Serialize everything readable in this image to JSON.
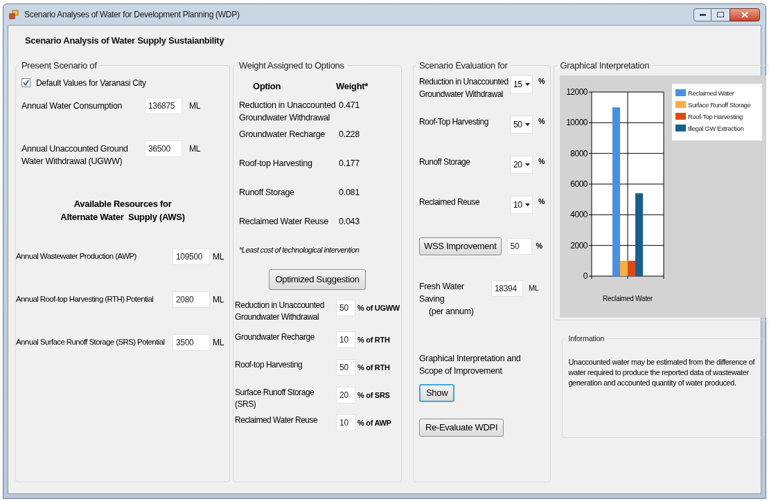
{
  "window": {
    "title": "Scenario Analyses of Water for Development Planning (WDP)"
  },
  "heading": "Scenario Analysis of Water Supply Sustaianbility",
  "present": {
    "title": "Present Scenario of",
    "checkbox": {
      "label": "Default Values for Varanasi City",
      "checked": true
    },
    "fields": [
      {
        "label": "Annual Water Consumption",
        "value": "136875",
        "unit": "ML"
      },
      {
        "label": "Annual Unaccounted Ground Water Withdrawal (UGWW)",
        "value": "36500",
        "unit": "ML"
      }
    ],
    "subheading": [
      "Available Resources for",
      "Alternate Water  Supply (AWS)"
    ],
    "resources": [
      {
        "label": "Annual Wastewater Production (AWP)",
        "value": "109500",
        "unit": "ML"
      },
      {
        "label": "Annual Roof-top Harvesting (RTH) Potential",
        "value": "2080",
        "unit": "ML"
      },
      {
        "label": "Annual Surface Runoff Storage (SRS) Potential",
        "value": "3500",
        "unit": "ML"
      }
    ]
  },
  "weights": {
    "title": "Weight Assigned to Options",
    "columns": [
      "Option",
      "Weight*"
    ],
    "rows": [
      {
        "option": "Reduction in Unaccounted Groundwater Withdrawal",
        "weight": "0.471"
      },
      {
        "option": "Groundwater Recharge",
        "weight": "0.228"
      },
      {
        "option": "Roof-top Harvesting",
        "weight": "0.177"
      },
      {
        "option": "Runoff Storage",
        "weight": "0.081"
      },
      {
        "option": "Reclaimed Water Reuse",
        "weight": "0.043"
      }
    ],
    "footnote": "*Least cost of technological intervention",
    "button": "Optimized Suggestion",
    "suggestions": [
      {
        "label": "Reduction in Unaccounted Groundwater Withdrawal",
        "value": "50",
        "unit": "% of UGWW"
      },
      {
        "label": "Groundwater Recharge",
        "value": "10",
        "unit": "% of RTH"
      },
      {
        "label": "Roof-top Harvesting",
        "value": "50",
        "unit": "% of RTH"
      },
      {
        "label": "Surface Runoff Storage (SRS)",
        "value": "20",
        "unit": "% of SRS"
      },
      {
        "label": "Reclaimed Water Reuse",
        "value": "10",
        "unit": "% of AWP"
      }
    ]
  },
  "evaluation": {
    "title": "Scenario Evaluation for",
    "options": [
      {
        "label": "Reduction in Unaccounted Groundwater Withdrawal",
        "value": "15",
        "unit": "%"
      },
      {
        "label": "Roof-Top Harvesting",
        "value": "50",
        "unit": "%"
      },
      {
        "label": "Runoff Storage",
        "value": "20",
        "unit": "%"
      },
      {
        "label": "Reclaimed Reuse",
        "value": "10",
        "unit": "%"
      }
    ],
    "improvement": {
      "button": "WSS Improvement",
      "value": "50",
      "unit": "%"
    },
    "saving": {
      "label": [
        "Fresh Water Saving",
        "(per annum)"
      ],
      "value": "18394",
      "unit": "ML"
    },
    "scope_label": "Graphical Interpretation and Scope of Improvement",
    "show_button": {
      "label": "Show",
      "focused": true
    },
    "reevaluate_button": "Re-Evaluate WDPI"
  },
  "graph": {
    "title": "Graphical Interpretation",
    "chart_data": {
      "type": "bar",
      "categories": [
        "Reclaimed Water"
      ],
      "series": [
        {
          "name": "Reclaimed Water",
          "color": "#4a90e2",
          "values": [
            11000
          ]
        },
        {
          "name": "Surface Runoff Storage",
          "color": "#f5b041",
          "values": [
            1000
          ]
        },
        {
          "name": "Roof-Top Harvesting",
          "color": "#dc4a1a",
          "values": [
            1000
          ]
        },
        {
          "name": "Illegal GW Extraction",
          "color": "#1a5f8a",
          "values": [
            5400
          ]
        }
      ],
      "ylim": [
        0,
        12000
      ],
      "grid": true,
      "legend": true,
      "yticks": [
        0,
        2000,
        4000,
        6000,
        8000,
        10000,
        12000
      ]
    }
  },
  "information": {
    "title": "Information",
    "text": "Unaccounted water may be estimated from the difference of water required to produce the reported data of wastewater generation and accounted quantity of water produced."
  }
}
